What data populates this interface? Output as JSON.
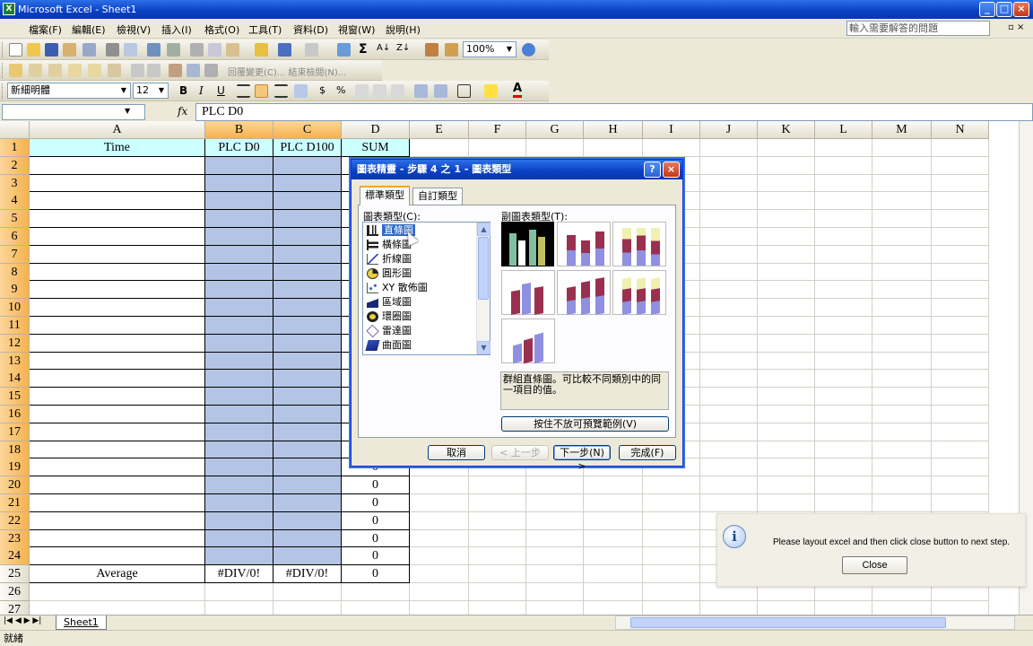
{
  "window": {
    "title": "Microsoft Excel - Sheet1"
  },
  "menu": [
    "檔案(F)",
    "編輯(E)",
    "檢視(V)",
    "插入(I)",
    "格式(O)",
    "工具(T)",
    "資料(D)",
    "視窗(W)",
    "說明(H)"
  ],
  "help_placeholder": "輸入需要解答的問題",
  "toolbar": {
    "zoom": "100%",
    "review_text": "回覆變更(C)... 結束檢閱(N)...",
    "font_name": "新細明體",
    "font_size": "12",
    "bold": "B",
    "italic": "I",
    "underline": "U",
    "currency": "$",
    "percent": "%"
  },
  "formula_bar": {
    "name_box": "",
    "fx": "fx",
    "value": "PLC D0"
  },
  "columns": [
    "A",
    "B",
    "C",
    "D",
    "E",
    "F",
    "G",
    "H",
    "I",
    "J",
    "K",
    "L",
    "M",
    "N"
  ],
  "rows": [
    "1",
    "2",
    "3",
    "4",
    "5",
    "6",
    "7",
    "8",
    "9",
    "10",
    "11",
    "12",
    "13",
    "14",
    "15",
    "16",
    "17",
    "18",
    "19",
    "20",
    "21",
    "22",
    "23",
    "24",
    "25",
    "26",
    "27"
  ],
  "cells": {
    "A1": "Time",
    "B1": "PLC D0",
    "C1": "PLC D100",
    "D1": "SUM",
    "A25": "Average",
    "B25": "#DIV/0!",
    "C25": "#DIV/0!",
    "D19": "0",
    "D20": "0",
    "D21": "0",
    "D22": "0",
    "D23": "0",
    "D24": "0",
    "D25": "0"
  },
  "sheet_tab": "Sheet1",
  "status": "就緒",
  "dialog": {
    "title": "圖表精靈 - 步驟 4 之 1 - 圖表類型",
    "help": "?",
    "close": "×",
    "tabs": [
      "標準類型",
      "自訂類型"
    ],
    "chart_type_label": "圖表類型(C):",
    "chart_types": [
      "直條圖",
      "橫條圖",
      "折線圖",
      "圓形圖",
      "XY 散佈圖",
      "區域圖",
      "環圈圖",
      "雷達圖",
      "曲面圖"
    ],
    "subtype_label": "副圖表類型(T):",
    "description": "群組直條圖。可比較不同類別中的同一項目的值。",
    "preview_button": "按住不放可預覽範例(V)",
    "cancel": "取消",
    "back": "< 上一步",
    "next": "下一步(N) >",
    "finish": "完成(F)"
  },
  "popup": {
    "message": "Please layout excel and then click close button to next step.",
    "close": "Close",
    "icon": "info-icon"
  }
}
